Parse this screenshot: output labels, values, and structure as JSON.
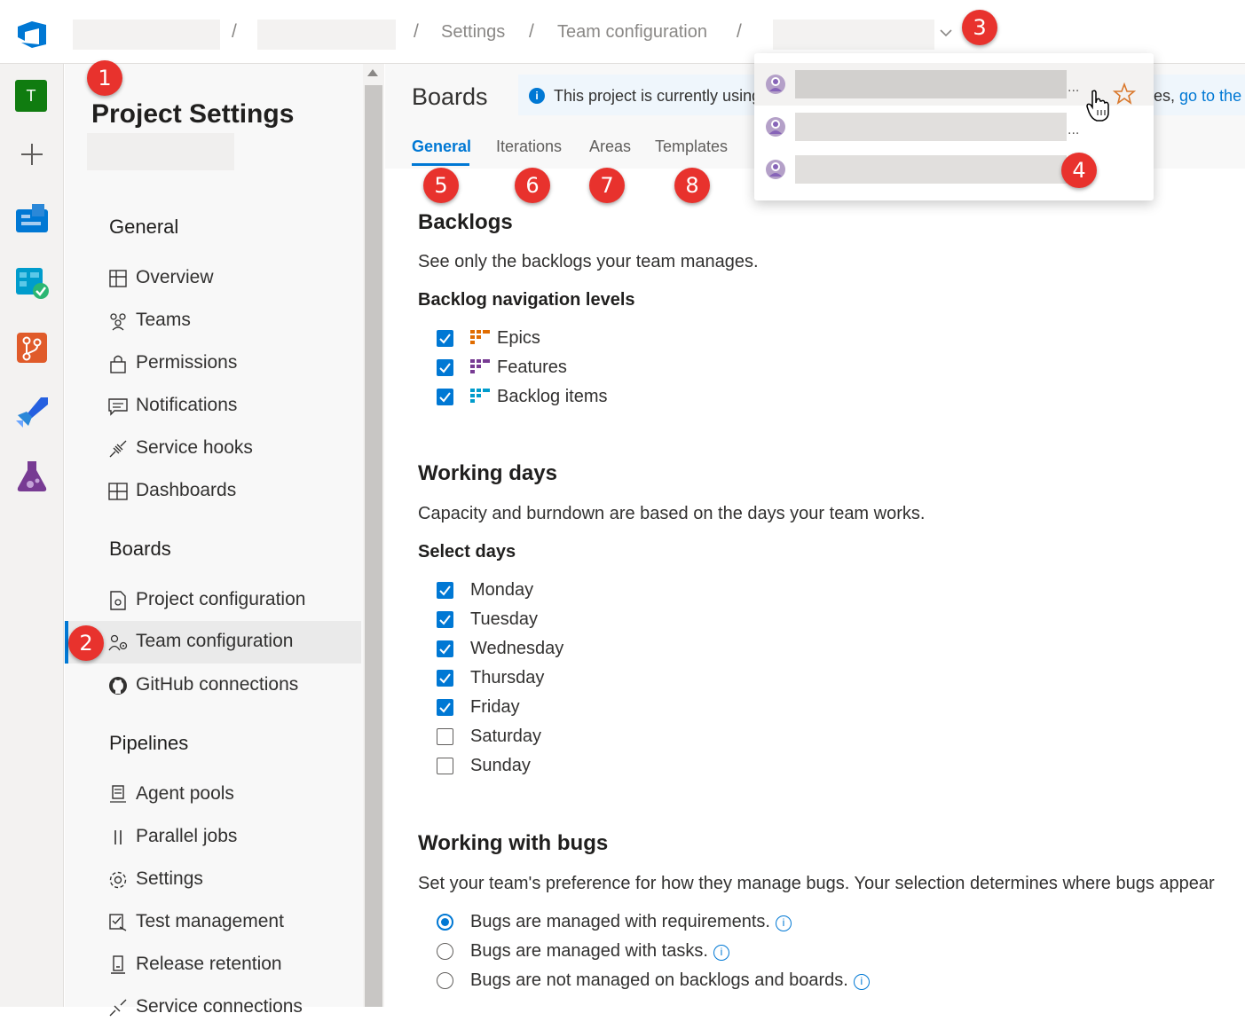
{
  "breadcrumb": {
    "sep": "/",
    "settings": "Settings",
    "team_configuration": "Team configuration"
  },
  "rail": {
    "avatar_letter": "T"
  },
  "nav": {
    "title": "Project Settings",
    "sections": {
      "general": "General",
      "boards": "Boards",
      "pipelines": "Pipelines"
    },
    "general_items": [
      {
        "label": "Overview",
        "icon": "overview-icon"
      },
      {
        "label": "Teams",
        "icon": "teams-icon"
      },
      {
        "label": "Permissions",
        "icon": "lock-icon"
      },
      {
        "label": "Notifications",
        "icon": "notifications-icon"
      },
      {
        "label": "Service hooks",
        "icon": "service-hooks-icon"
      },
      {
        "label": "Dashboards",
        "icon": "dashboards-icon"
      }
    ],
    "boards_items": [
      {
        "label": "Project configuration",
        "icon": "project-config-icon"
      },
      {
        "label": "Team configuration",
        "icon": "team-config-icon",
        "selected": true
      },
      {
        "label": "GitHub connections",
        "icon": "github-icon"
      }
    ],
    "pipelines_items": [
      {
        "label": "Agent pools",
        "icon": "agent-pools-icon"
      },
      {
        "label": "Parallel jobs",
        "icon": "parallel-jobs-icon"
      },
      {
        "label": "Settings",
        "icon": "gear-icon"
      },
      {
        "label": "Test management",
        "icon": "test-management-icon"
      },
      {
        "label": "Release retention",
        "icon": "release-retention-icon"
      },
      {
        "label": "Service connections",
        "icon": "service-connections-icon"
      }
    ]
  },
  "header": {
    "title": "Boards",
    "info_text": "This project is currently using",
    "info_right_prefix": "es, ",
    "info_link": "go to the",
    "tabs": [
      "General",
      "Iterations",
      "Areas",
      "Templates"
    ],
    "active_tab": "General"
  },
  "backlogs": {
    "heading": "Backlogs",
    "description": "See only the backlogs your team manages.",
    "subheading": "Backlog navigation levels",
    "levels": [
      {
        "label": "Epics",
        "checked": true,
        "color": "#e06c00"
      },
      {
        "label": "Features",
        "checked": true,
        "color": "#773b93"
      },
      {
        "label": "Backlog items",
        "checked": true,
        "color": "#009ccc"
      }
    ]
  },
  "working_days": {
    "heading": "Working days",
    "description": "Capacity and burndown are based on the days your team works.",
    "subheading": "Select days",
    "days": [
      {
        "label": "Monday",
        "checked": true
      },
      {
        "label": "Tuesday",
        "checked": true
      },
      {
        "label": "Wednesday",
        "checked": true
      },
      {
        "label": "Thursday",
        "checked": true
      },
      {
        "label": "Friday",
        "checked": true
      },
      {
        "label": "Saturday",
        "checked": false
      },
      {
        "label": "Sunday",
        "checked": false
      }
    ]
  },
  "bugs": {
    "heading": "Working with bugs",
    "description": "Set your team's preference for how they manage bugs. Your selection determines where bugs appear",
    "options": [
      {
        "label": "Bugs are managed with requirements.",
        "selected": true
      },
      {
        "label": "Bugs are managed with tasks.",
        "selected": false
      },
      {
        "label": "Bugs are not managed on backlogs and boards.",
        "selected": false
      }
    ],
    "info_glyph": "i"
  },
  "dropdown": {
    "ellipsis": "..."
  },
  "info_glyph": "i",
  "markers": [
    "1",
    "2",
    "3",
    "4",
    "5",
    "6",
    "7",
    "8"
  ],
  "colors": {
    "accent": "#0078d4",
    "marker": "#e8322d",
    "star": "#d9772b"
  }
}
